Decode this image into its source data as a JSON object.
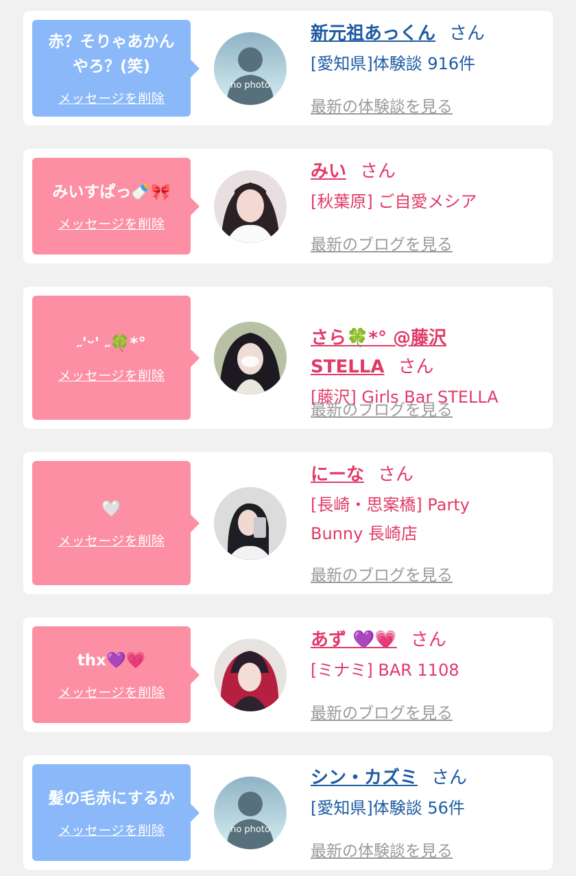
{
  "delete_label": "メッセージを削除",
  "san": "さん",
  "colors": {
    "blue_bubble": "#8ab8f8",
    "pink_bubble": "#fc8fa3",
    "blue_text": "#1c5aa2",
    "pink_text": "#e03a68"
  },
  "cards": [
    {
      "message": "赤？そりゃあかん\nやろ？(笑)",
      "name": "新元祖あっくん",
      "sub": "[愛知県]体験談 916件",
      "latest": "最新の体験談を見る",
      "avatar": "no photo"
    },
    {
      "message": "みいすぱっ🍼🎀",
      "name": "みい",
      "sub": "[秋葉原] ご自愛メシア",
      "latest": "最新のブログを見る",
      "avatar": "profile-photo"
    },
    {
      "message": "˶'ᵕ' ˶🍀*°",
      "name": "さら🍀*° @藤沢\nSTELLA",
      "sub": "[藤沢] Girls Bar STELLA",
      "latest": "最新のブログを見る",
      "avatar": "profile-photo"
    },
    {
      "message": "🤍",
      "name": "にーな",
      "sub": "[長崎・思案橋] Party\nBunny 長崎店",
      "latest": "最新のブログを見る",
      "avatar": "profile-photo"
    },
    {
      "message": "thx💜💗",
      "name": "あず 💜💗",
      "sub": "[ミナミ] BAR 1108",
      "latest": "最新のブログを見る",
      "avatar": "profile-photo"
    },
    {
      "message": "髪の毛赤にするか",
      "name": "シン・カズミ",
      "sub": "[愛知県]体験談 56件",
      "latest": "最新の体験談を見る",
      "avatar": "no photo"
    }
  ]
}
